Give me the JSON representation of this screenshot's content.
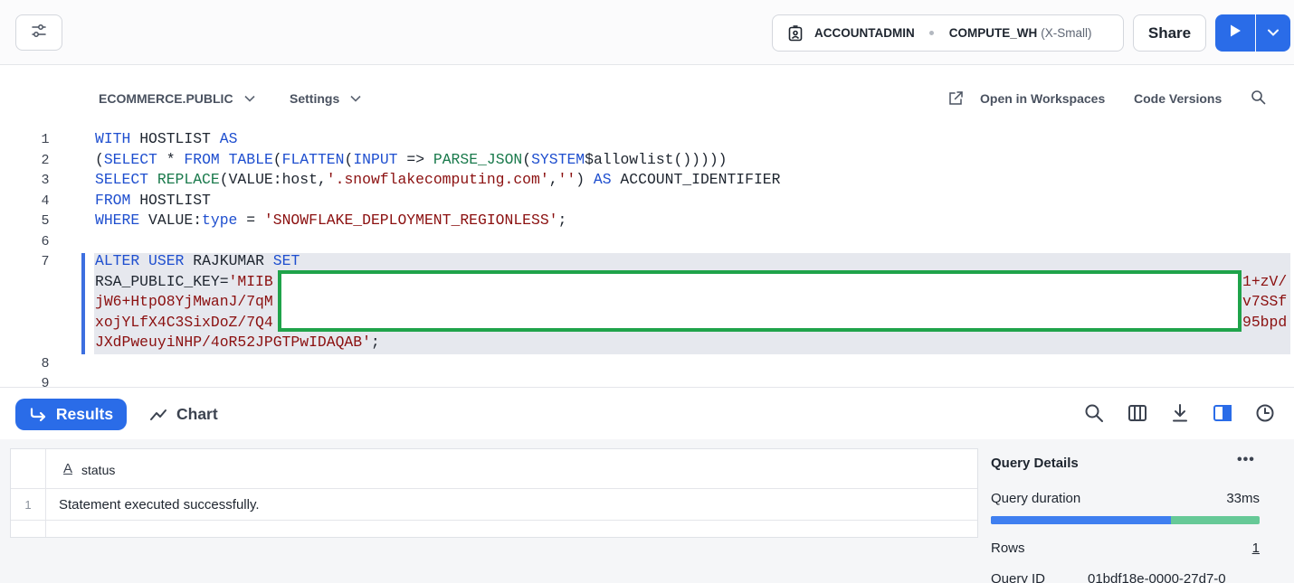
{
  "topbar": {
    "role": "ACCOUNTADMIN",
    "warehouse": "COMPUTE_WH",
    "warehouse_size": "(X-Small)",
    "share_label": "Share"
  },
  "editor_header": {
    "database_schema": "ECOMMERCE.PUBLIC",
    "settings_label": "Settings",
    "open_workspaces_label": "Open in Workspaces",
    "code_versions_label": "Code Versions"
  },
  "code": {
    "line_numbers": [
      "1",
      "2",
      "3",
      "4",
      "5",
      "6",
      "7",
      "8",
      "9"
    ],
    "l1_kw1": "WITH",
    "l1_t1": " HOSTLIST ",
    "l1_kw2": "AS",
    "l2_t1": "(",
    "l2_kw1": "SELECT",
    "l2_t2": " * ",
    "l2_kw2": "FROM",
    "l2_t3": " ",
    "l2_kw3": "TABLE",
    "l2_t4": "(",
    "l2_kw4": "FLATTEN",
    "l2_t5": "(",
    "l2_kw5": "INPUT",
    "l2_t6": " => ",
    "l2_fn1": "PARSE_JSON",
    "l2_t7": "(",
    "l2_kw6": "SYSTEM",
    "l2_t8": "$allowlist()))))",
    "l3_kw1": "SELECT",
    "l3_t1": " ",
    "l3_fn1": "REPLACE",
    "l3_t2": "(VALUE:host,",
    "l3_s1": "'.snowflakecomputing.com'",
    "l3_t3": ",",
    "l3_s2": "''",
    "l3_t4": ") ",
    "l3_kw2": "AS",
    "l3_t5": " ACCOUNT_IDENTIFIER",
    "l4_kw1": "FROM",
    "l4_t1": " HOSTLIST",
    "l5_kw1": "WHERE",
    "l5_t1": " VALUE:",
    "l5_kw2": "type",
    "l5_t2": " = ",
    "l5_s1": "'SNOWFLAKE_DEPLOYMENT_REGIONLESS'",
    "l5_t3": ";",
    "l7_kw1": "ALTER",
    "l7_t1": " ",
    "l7_kw2": "USER",
    "l7_t2": " RAJKUMAR ",
    "l7_kw3": "SET",
    "l7b_t1": "RSA_PUBLIC_KEY=",
    "l7b_s1": "'MIIB",
    "l7b_tail": "1+zV/",
    "l7c_s1": "jW6+HtpO8YjMwanJ/7qM",
    "l7c_tail": "v7SSf",
    "l7d_s1": "xojYLfX4C3SixDoZ/7Q4",
    "l7d_tail": "95bpd",
    "l7e_s1": "JXdPweuyiNHP/4oR52JPGTPwIDAQAB'",
    "l7e_t1": ";"
  },
  "results_bar": {
    "results_label": "Results",
    "chart_label": "Chart"
  },
  "results_grid": {
    "type_glyph": "A",
    "column_header": "status",
    "rows": [
      {
        "num": "1",
        "status": "Statement executed successfully."
      }
    ]
  },
  "query_details": {
    "title": "Query Details",
    "more": "•••",
    "duration_label": "Query duration",
    "duration_value": "33ms",
    "duration_split": 0.67,
    "rows_label": "Rows",
    "rows_value": "1",
    "query_id_label": "Query ID",
    "query_id_value": "01bdf18e-0000-27d7-0"
  },
  "colors": {
    "accent": "#2a6ce8",
    "keyword": "#1f4fcf",
    "function": "#1a7a4c",
    "string": "#8b1010",
    "redact_border": "#1fa34a"
  }
}
